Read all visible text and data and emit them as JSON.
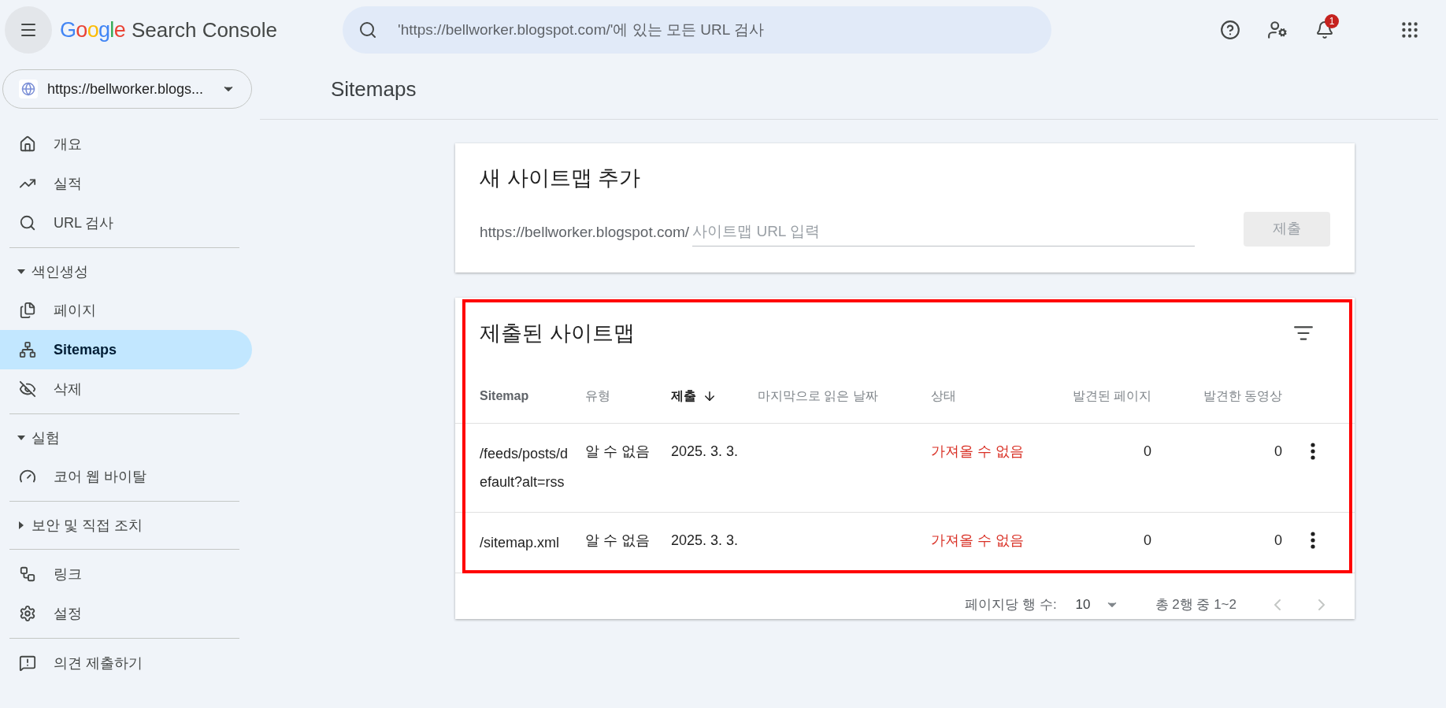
{
  "header": {
    "logo": "Google",
    "product": "Search Console",
    "search_placeholder": "'https://bellworker.blogspot.com/'에 있는 모든 URL 검사",
    "notification_count": "1"
  },
  "property": {
    "label": "https://bellworker.blogs..."
  },
  "sidebar": {
    "groups": [
      {
        "items": [
          {
            "label": "개요",
            "selected": false
          },
          {
            "label": "실적",
            "selected": false
          },
          {
            "label": "URL 검사",
            "selected": false
          }
        ]
      },
      {
        "header": {
          "label": "색인생성",
          "expanded": true
        },
        "items": [
          {
            "label": "페이지",
            "selected": false
          },
          {
            "label": "Sitemaps",
            "selected": true
          },
          {
            "label": "삭제",
            "selected": false
          }
        ]
      },
      {
        "header": {
          "label": "실험",
          "expanded": true
        },
        "items": [
          {
            "label": "코어 웹 바이탈",
            "selected": false
          }
        ]
      },
      {
        "header": {
          "label": "보안 및 직접 조치",
          "expanded": false
        }
      },
      {
        "items": [
          {
            "label": "링크",
            "selected": false
          },
          {
            "label": "설정",
            "selected": false
          }
        ]
      },
      {
        "items": [
          {
            "label": "의견 제출하기",
            "selected": false
          }
        ]
      }
    ]
  },
  "page_title": "Sitemaps",
  "add_card": {
    "title": "새 사이트맵 추가",
    "prefix": "https://bellworker.blogspot.com/",
    "placeholder": "사이트맵 URL 입력",
    "submit": {
      "label": "제출",
      "disabled": true
    }
  },
  "submitted_card": {
    "title": "제출된 사이트맵",
    "columns": [
      {
        "label": "Sitemap",
        "sorted": false
      },
      {
        "label": "유형",
        "sorted": false
      },
      {
        "label": "제출",
        "sorted": true
      },
      {
        "label": "마지막으로 읽은 날짜",
        "sorted": false
      },
      {
        "label": "상태",
        "sorted": false
      },
      {
        "label": "발견된 페이지",
        "sorted": false
      },
      {
        "label": "발견한 동영상",
        "sorted": false
      }
    ],
    "rows": [
      {
        "sitemap": "/feeds/posts/default?alt=rss",
        "type": "알 수 없음",
        "submitted": "2025. 3. 3.",
        "status": "가져올 수 없음",
        "error": true,
        "pages": "0",
        "videos": "0"
      },
      {
        "sitemap": "/sitemap.xml",
        "type": "알 수 없음",
        "submitted": "2025. 3. 3.",
        "status": "가져올 수 없음",
        "error": true,
        "pages": "0",
        "videos": "0"
      }
    ],
    "pagination": {
      "rows_label": "페이지당 행 수:",
      "rows_value": "10",
      "range": "총 2행 중 1~2",
      "prev_disabled": true,
      "next_disabled": true
    }
  }
}
